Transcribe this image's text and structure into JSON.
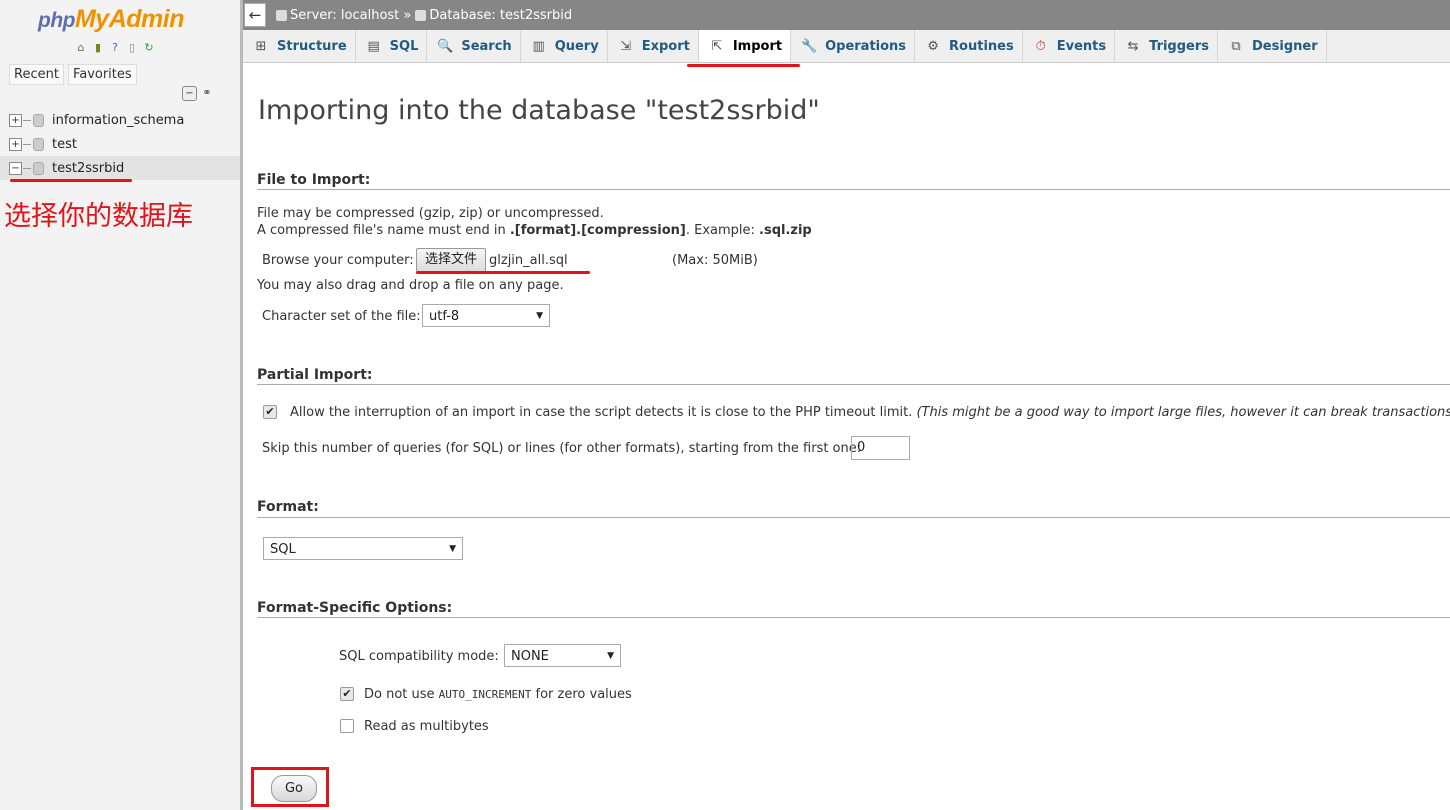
{
  "sidebar": {
    "logo_php": "php",
    "logo_myadmin": "MyAdmin",
    "logo_icons": [
      "home-icon",
      "logout-icon",
      "help-icon",
      "docs-icon",
      "reload-icon"
    ],
    "recent_label": "Recent",
    "favorites_label": "Favorites",
    "databases": [
      {
        "name": "information_schema",
        "expander": "+"
      },
      {
        "name": "test",
        "expander": "+"
      },
      {
        "name": "test2ssrbid",
        "expander": "−",
        "active": true
      }
    ],
    "annotation": "选择你的数据库"
  },
  "topbar": {
    "back": "←",
    "server": "Server: localhost »",
    "database": "Database: test2ssrbid"
  },
  "tabs": [
    {
      "label": "Structure",
      "icon": "structure-icon",
      "glyph": "⊞"
    },
    {
      "label": "SQL",
      "icon": "sql-icon",
      "glyph": "▤"
    },
    {
      "label": "Search",
      "icon": "search-icon",
      "glyph": "🔍"
    },
    {
      "label": "Query",
      "icon": "query-icon",
      "glyph": "▥"
    },
    {
      "label": "Export",
      "icon": "export-icon",
      "glyph": "⇲"
    },
    {
      "label": "Import",
      "icon": "import-icon",
      "glyph": "⇱",
      "active": true
    },
    {
      "label": "Operations",
      "icon": "wrench-icon",
      "glyph": "🔧"
    },
    {
      "label": "Routines",
      "icon": "routines-icon",
      "glyph": "⚙"
    },
    {
      "label": "Events",
      "icon": "clock-icon",
      "glyph": "⏱"
    },
    {
      "label": "Triggers",
      "icon": "triggers-icon",
      "glyph": "⇆"
    },
    {
      "label": "Designer",
      "icon": "designer-icon",
      "glyph": "⧉"
    }
  ],
  "main": {
    "heading": "Importing into the database \"test2ssrbid\"",
    "file_section": {
      "title": "File to Import:",
      "line1": "File may be compressed (gzip, zip) or uncompressed.",
      "line2_prefix": "A compressed file's name must end in ",
      "line2_format": ".[format].[compression]",
      "line2_mid": ". Example: ",
      "line2_example": ".sql.zip",
      "browse_label": "Browse your computer:",
      "choose_file_button": "选择文件",
      "chosen_file": "glzjin_all.sql",
      "max_size": "(Max: 50MiB)",
      "drag_hint": "You may also drag and drop a file on any page.",
      "charset_label": "Character set of the file:",
      "charset_value": "utf-8"
    },
    "partial_section": {
      "title": "Partial Import:",
      "allow_interrupt_label": "Allow the interruption of an import in case the script detects it is close to the PHP timeout limit.",
      "allow_interrupt_note": "(This might be a good way to import large files, however it can break transactions.)",
      "allow_interrupt_checked": true,
      "skip_label": "Skip this number of queries (for SQL) or lines (for other formats), starting from the first one:",
      "skip_value": "0"
    },
    "format_section": {
      "title": "Format:",
      "format_value": "SQL"
    },
    "options_section": {
      "title": "Format-Specific Options:",
      "compat_label": "SQL compatibility mode:",
      "compat_value": "NONE",
      "no_auto_inc_prefix": "Do not use ",
      "no_auto_inc_code": "AUTO_INCREMENT",
      "no_auto_inc_suffix": " for zero values",
      "no_auto_inc_checked": true,
      "multibytes_label": "Read as multibytes",
      "multibytes_checked": false
    },
    "go_button": "Go"
  },
  "colors": {
    "annotation_red": "#e0141b",
    "tab_link": "#235a81",
    "topbar_bg": "#868686"
  }
}
